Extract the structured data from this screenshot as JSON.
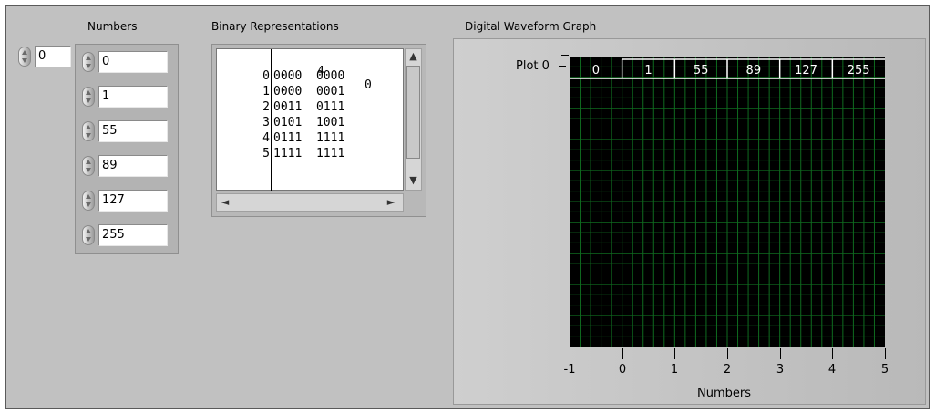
{
  "labels": {
    "numbers": "Numbers",
    "binary": "Binary Representations",
    "graph": "Digital Waveform Graph",
    "xaxis": "Numbers",
    "plot": "Plot 0"
  },
  "index_value": "0",
  "numbers": [
    "0",
    "1",
    "55",
    "89",
    "127",
    "255"
  ],
  "table": {
    "col_headers": [
      "4",
      "0"
    ],
    "rows": [
      {
        "idx": "0",
        "bits": "0000  0000"
      },
      {
        "idx": "1",
        "bits": "0000  0001"
      },
      {
        "idx": "2",
        "bits": "0011  0111"
      },
      {
        "idx": "3",
        "bits": "0101  1001"
      },
      {
        "idx": "4",
        "bits": "0111  1111"
      },
      {
        "idx": "5",
        "bits": "1111  1111"
      }
    ]
  },
  "graph": {
    "x_ticks": [
      "-1",
      "0",
      "1",
      "2",
      "3",
      "4",
      "5"
    ],
    "segments": [
      "0",
      "1",
      "55",
      "89",
      "127",
      "255"
    ],
    "plot_bg": "#000000",
    "grid_color": "#0f6b1f",
    "trace_color": "#ffffff"
  }
}
